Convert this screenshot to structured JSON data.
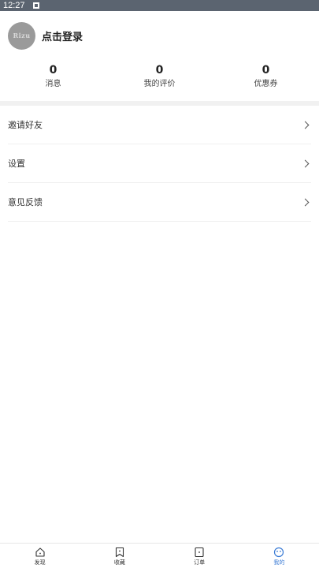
{
  "status_bar": {
    "time": "12:27",
    "notification_icon": "image-notification-icon"
  },
  "profile": {
    "avatar_text": "Rizu",
    "login_label": "点击登录"
  },
  "stats": [
    {
      "value": "0",
      "label": "消息"
    },
    {
      "value": "0",
      "label": "我的评价"
    },
    {
      "value": "0",
      "label": "优惠券"
    }
  ],
  "menu": [
    {
      "label": "邀请好友"
    },
    {
      "label": "设置"
    },
    {
      "label": "意见反馈"
    }
  ],
  "bottom_nav": [
    {
      "label": "发现",
      "icon": "house-icon",
      "active": false
    },
    {
      "label": "收藏",
      "icon": "bookmark-icon",
      "active": false
    },
    {
      "label": "订单",
      "icon": "order-icon",
      "active": false
    },
    {
      "label": "我的",
      "icon": "smiley-icon",
      "active": true
    }
  ],
  "colors": {
    "accent": "#3a7bd5",
    "status_bar": "#5b6470"
  }
}
